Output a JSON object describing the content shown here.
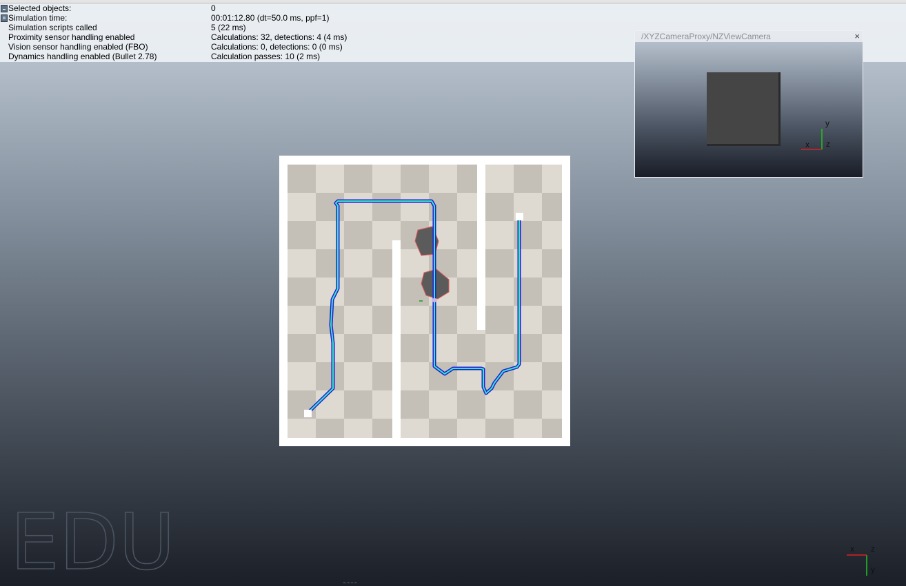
{
  "info_panel": {
    "rows": [
      {
        "label": "Selected objects:",
        "value": "0"
      },
      {
        "label": "Simulation time:",
        "value": "00:01:12.80 (dt=50.0 ms, ppf=1)"
      },
      {
        "label": "Simulation scripts called",
        "value": "5 (22 ms)"
      },
      {
        "label": "Proximity sensor handling enabled",
        "value": "Calculations: 32, detections: 4 (4 ms)"
      },
      {
        "label": "Vision sensor handling enabled (FBO)",
        "value": "Calculations: 0, detections: 0 (0 ms)"
      },
      {
        "label": "Dynamics handling enabled (Bullet 2.78)",
        "value": "Calculation passes: 10 (2 ms)"
      }
    ]
  },
  "camera_view": {
    "title": "/XYZCameraProxy/NZViewCamera",
    "close_glyph": "×",
    "axes": {
      "x": "x",
      "y": "y",
      "z": "z"
    }
  },
  "main_axes": {
    "x": "x",
    "y": "y",
    "z": "z"
  },
  "watermark": "EDU",
  "colors": {
    "path_outer": "#1f1fd6",
    "path_inner": "#3ce6c4",
    "obstacle": "#5b5b5b",
    "obstacle_outline": "#e05858",
    "wall": "#ffffff",
    "floor_light": "#dedad2",
    "floor_dark": "#c4c0b8"
  }
}
